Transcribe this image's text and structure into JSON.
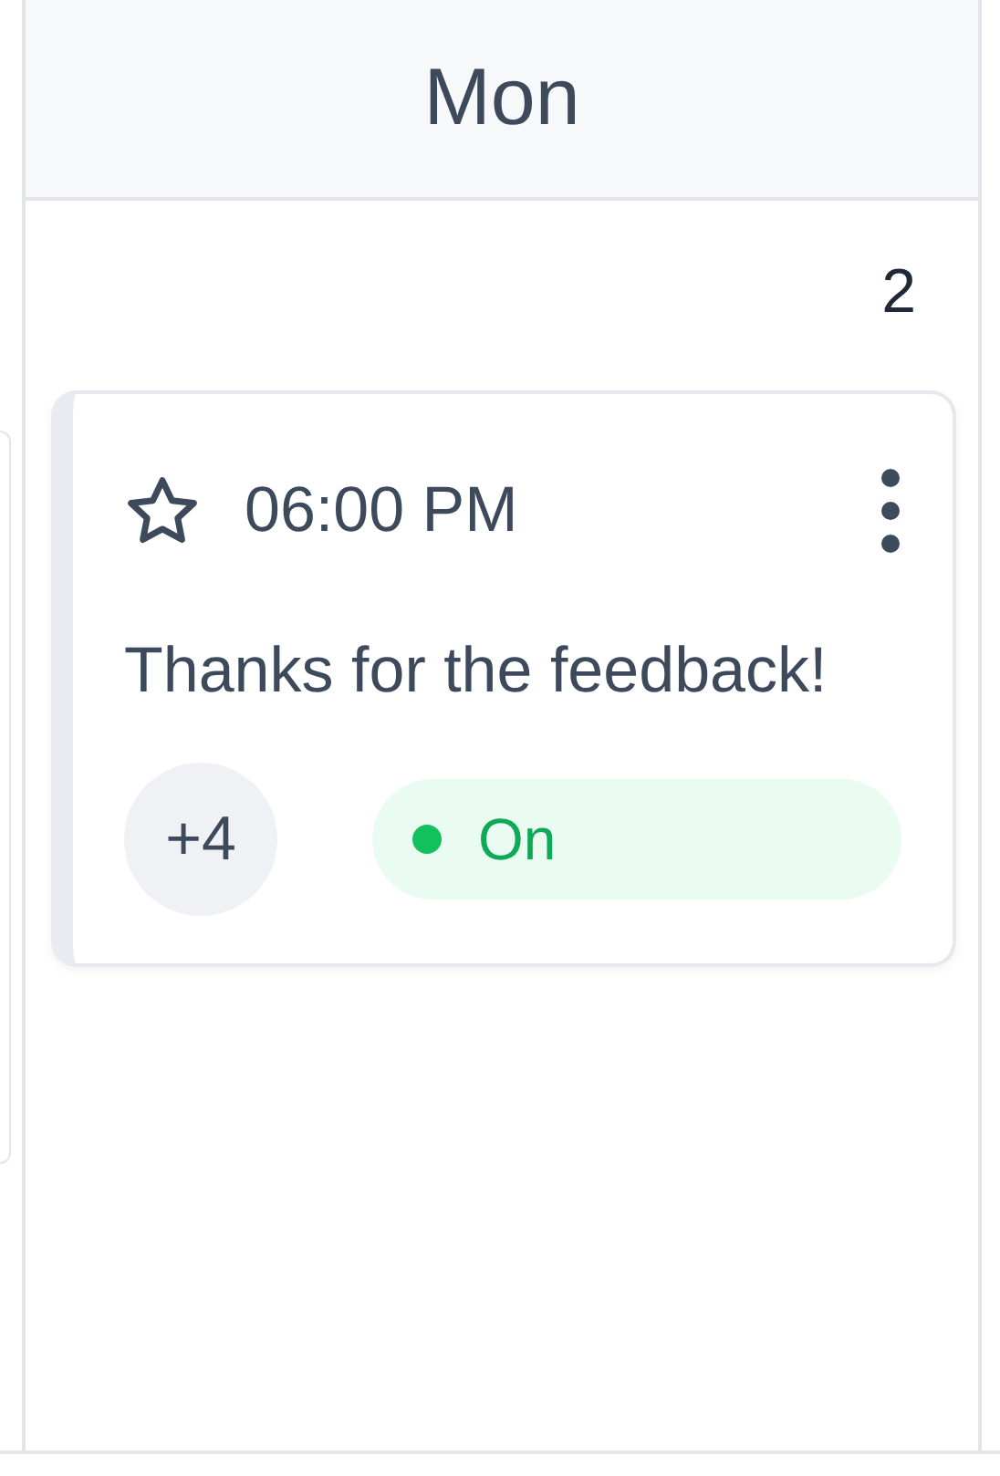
{
  "day_header": {
    "label": "Mon"
  },
  "day_number": "2",
  "events": [
    {
      "time": "06:00 PM",
      "starred": false,
      "text": "Thanks for the feedback!",
      "extra_count": "+4",
      "status": {
        "label": "On",
        "color": "#12c15e"
      }
    }
  ]
}
